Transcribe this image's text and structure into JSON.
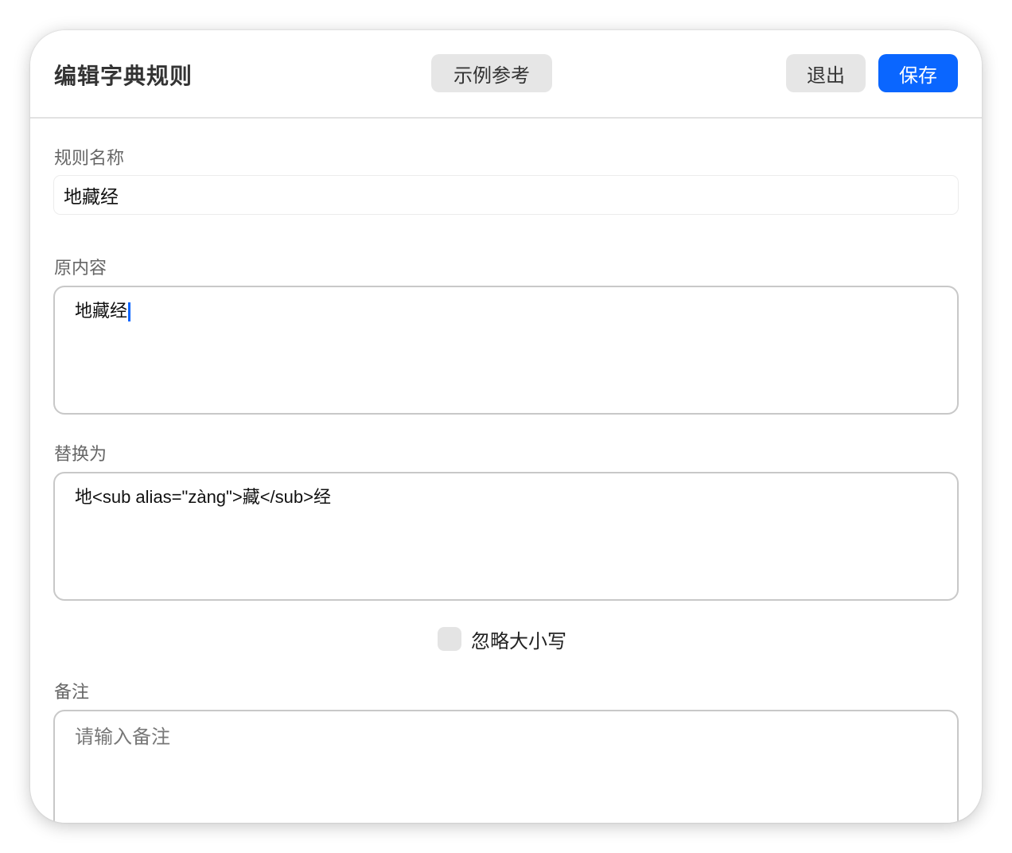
{
  "header": {
    "title": "编辑字典规则",
    "example_label": "示例参考",
    "exit_label": "退出",
    "save_label": "保存"
  },
  "colors": {
    "accent": "#0a66ff",
    "button_gray": "#e6e6e6"
  },
  "form": {
    "rule_name_label": "规则名称",
    "rule_name_value": "地藏经",
    "original_label": "原内容",
    "original_value": "地藏经",
    "replace_label": "替换为",
    "replace_value": "地<sub alias=\"zàng\">藏</sub>经",
    "ignore_case_label": "忽略大小写",
    "ignore_case_checked": false,
    "note_label": "备注",
    "note_placeholder": "请输入备注",
    "note_value": ""
  }
}
